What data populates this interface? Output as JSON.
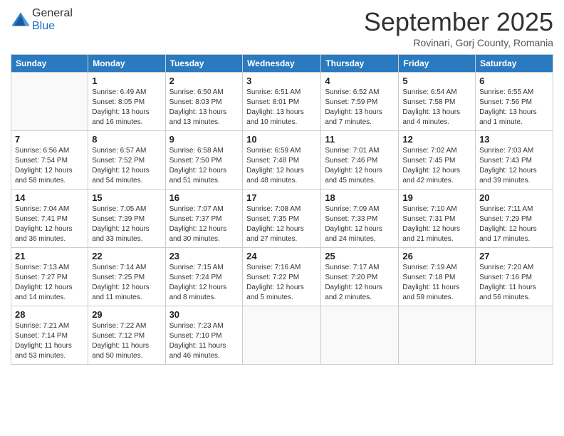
{
  "logo": {
    "general": "General",
    "blue": "Blue"
  },
  "title": "September 2025",
  "location": "Rovinari, Gorj County, Romania",
  "headers": [
    "Sunday",
    "Monday",
    "Tuesday",
    "Wednesday",
    "Thursday",
    "Friday",
    "Saturday"
  ],
  "weeks": [
    [
      {
        "day": "",
        "sunrise": "",
        "sunset": "",
        "daylight": ""
      },
      {
        "day": "1",
        "sunrise": "Sunrise: 6:49 AM",
        "sunset": "Sunset: 8:05 PM",
        "daylight": "Daylight: 13 hours and 16 minutes."
      },
      {
        "day": "2",
        "sunrise": "Sunrise: 6:50 AM",
        "sunset": "Sunset: 8:03 PM",
        "daylight": "Daylight: 13 hours and 13 minutes."
      },
      {
        "day": "3",
        "sunrise": "Sunrise: 6:51 AM",
        "sunset": "Sunset: 8:01 PM",
        "daylight": "Daylight: 13 hours and 10 minutes."
      },
      {
        "day": "4",
        "sunrise": "Sunrise: 6:52 AM",
        "sunset": "Sunset: 7:59 PM",
        "daylight": "Daylight: 13 hours and 7 minutes."
      },
      {
        "day": "5",
        "sunrise": "Sunrise: 6:54 AM",
        "sunset": "Sunset: 7:58 PM",
        "daylight": "Daylight: 13 hours and 4 minutes."
      },
      {
        "day": "6",
        "sunrise": "Sunrise: 6:55 AM",
        "sunset": "Sunset: 7:56 PM",
        "daylight": "Daylight: 13 hours and 1 minute."
      }
    ],
    [
      {
        "day": "7",
        "sunrise": "Sunrise: 6:56 AM",
        "sunset": "Sunset: 7:54 PM",
        "daylight": "Daylight: 12 hours and 58 minutes."
      },
      {
        "day": "8",
        "sunrise": "Sunrise: 6:57 AM",
        "sunset": "Sunset: 7:52 PM",
        "daylight": "Daylight: 12 hours and 54 minutes."
      },
      {
        "day": "9",
        "sunrise": "Sunrise: 6:58 AM",
        "sunset": "Sunset: 7:50 PM",
        "daylight": "Daylight: 12 hours and 51 minutes."
      },
      {
        "day": "10",
        "sunrise": "Sunrise: 6:59 AM",
        "sunset": "Sunset: 7:48 PM",
        "daylight": "Daylight: 12 hours and 48 minutes."
      },
      {
        "day": "11",
        "sunrise": "Sunrise: 7:01 AM",
        "sunset": "Sunset: 7:46 PM",
        "daylight": "Daylight: 12 hours and 45 minutes."
      },
      {
        "day": "12",
        "sunrise": "Sunrise: 7:02 AM",
        "sunset": "Sunset: 7:45 PM",
        "daylight": "Daylight: 12 hours and 42 minutes."
      },
      {
        "day": "13",
        "sunrise": "Sunrise: 7:03 AM",
        "sunset": "Sunset: 7:43 PM",
        "daylight": "Daylight: 12 hours and 39 minutes."
      }
    ],
    [
      {
        "day": "14",
        "sunrise": "Sunrise: 7:04 AM",
        "sunset": "Sunset: 7:41 PM",
        "daylight": "Daylight: 12 hours and 36 minutes."
      },
      {
        "day": "15",
        "sunrise": "Sunrise: 7:05 AM",
        "sunset": "Sunset: 7:39 PM",
        "daylight": "Daylight: 12 hours and 33 minutes."
      },
      {
        "day": "16",
        "sunrise": "Sunrise: 7:07 AM",
        "sunset": "Sunset: 7:37 PM",
        "daylight": "Daylight: 12 hours and 30 minutes."
      },
      {
        "day": "17",
        "sunrise": "Sunrise: 7:08 AM",
        "sunset": "Sunset: 7:35 PM",
        "daylight": "Daylight: 12 hours and 27 minutes."
      },
      {
        "day": "18",
        "sunrise": "Sunrise: 7:09 AM",
        "sunset": "Sunset: 7:33 PM",
        "daylight": "Daylight: 12 hours and 24 minutes."
      },
      {
        "day": "19",
        "sunrise": "Sunrise: 7:10 AM",
        "sunset": "Sunset: 7:31 PM",
        "daylight": "Daylight: 12 hours and 21 minutes."
      },
      {
        "day": "20",
        "sunrise": "Sunrise: 7:11 AM",
        "sunset": "Sunset: 7:29 PM",
        "daylight": "Daylight: 12 hours and 17 minutes."
      }
    ],
    [
      {
        "day": "21",
        "sunrise": "Sunrise: 7:13 AM",
        "sunset": "Sunset: 7:27 PM",
        "daylight": "Daylight: 12 hours and 14 minutes."
      },
      {
        "day": "22",
        "sunrise": "Sunrise: 7:14 AM",
        "sunset": "Sunset: 7:25 PM",
        "daylight": "Daylight: 12 hours and 11 minutes."
      },
      {
        "day": "23",
        "sunrise": "Sunrise: 7:15 AM",
        "sunset": "Sunset: 7:24 PM",
        "daylight": "Daylight: 12 hours and 8 minutes."
      },
      {
        "day": "24",
        "sunrise": "Sunrise: 7:16 AM",
        "sunset": "Sunset: 7:22 PM",
        "daylight": "Daylight: 12 hours and 5 minutes."
      },
      {
        "day": "25",
        "sunrise": "Sunrise: 7:17 AM",
        "sunset": "Sunset: 7:20 PM",
        "daylight": "Daylight: 12 hours and 2 minutes."
      },
      {
        "day": "26",
        "sunrise": "Sunrise: 7:19 AM",
        "sunset": "Sunset: 7:18 PM",
        "daylight": "Daylight: 11 hours and 59 minutes."
      },
      {
        "day": "27",
        "sunrise": "Sunrise: 7:20 AM",
        "sunset": "Sunset: 7:16 PM",
        "daylight": "Daylight: 11 hours and 56 minutes."
      }
    ],
    [
      {
        "day": "28",
        "sunrise": "Sunrise: 7:21 AM",
        "sunset": "Sunset: 7:14 PM",
        "daylight": "Daylight: 11 hours and 53 minutes."
      },
      {
        "day": "29",
        "sunrise": "Sunrise: 7:22 AM",
        "sunset": "Sunset: 7:12 PM",
        "daylight": "Daylight: 11 hours and 50 minutes."
      },
      {
        "day": "30",
        "sunrise": "Sunrise: 7:23 AM",
        "sunset": "Sunset: 7:10 PM",
        "daylight": "Daylight: 11 hours and 46 minutes."
      },
      {
        "day": "",
        "sunrise": "",
        "sunset": "",
        "daylight": ""
      },
      {
        "day": "",
        "sunrise": "",
        "sunset": "",
        "daylight": ""
      },
      {
        "day": "",
        "sunrise": "",
        "sunset": "",
        "daylight": ""
      },
      {
        "day": "",
        "sunrise": "",
        "sunset": "",
        "daylight": ""
      }
    ]
  ]
}
